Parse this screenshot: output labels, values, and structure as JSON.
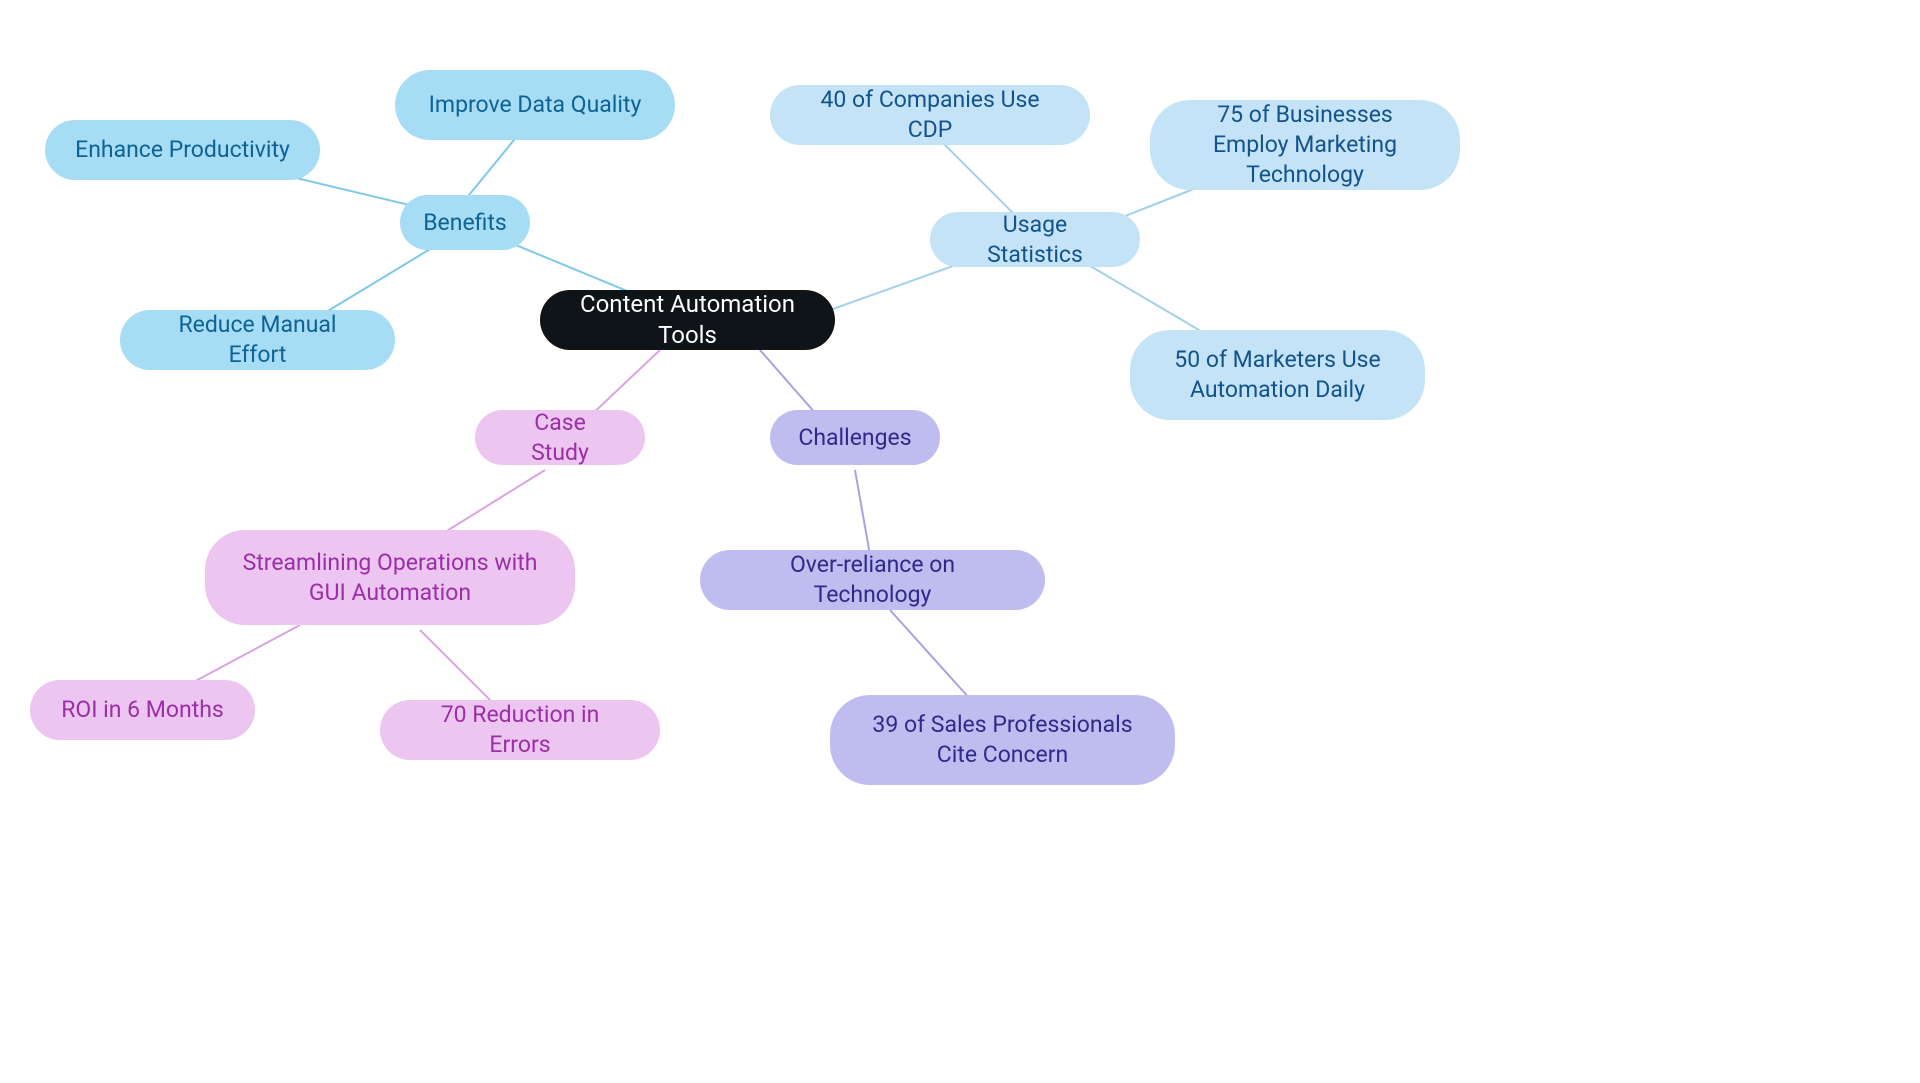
{
  "center": {
    "label": "Content Automation Tools"
  },
  "benefits": {
    "label": "Benefits",
    "children": {
      "productivity": "Enhance Productivity",
      "dataquality": "Improve Data Quality",
      "manual": "Reduce Manual Effort"
    }
  },
  "usage": {
    "label": "Usage Statistics",
    "children": {
      "cdp": "40 of Companies Use CDP",
      "martech": "75 of Businesses Employ Marketing Technology",
      "daily": "50 of Marketers Use Automation Daily"
    }
  },
  "casestudy": {
    "label": "Case Study",
    "child": "Streamlining Operations with GUI Automation",
    "leaves": {
      "roi": "ROI in 6 Months",
      "errors": "70 Reduction in Errors"
    }
  },
  "challenges": {
    "label": "Challenges",
    "child": "Over-reliance on Technology",
    "leaf": "39 of Sales Professionals Cite Concern"
  },
  "colors": {
    "benefits_line": "#7fc8e8",
    "usage_line": "#a3d0ea",
    "casestudy_line": "#dca3e3",
    "challenges_line": "#a6a3e0"
  }
}
